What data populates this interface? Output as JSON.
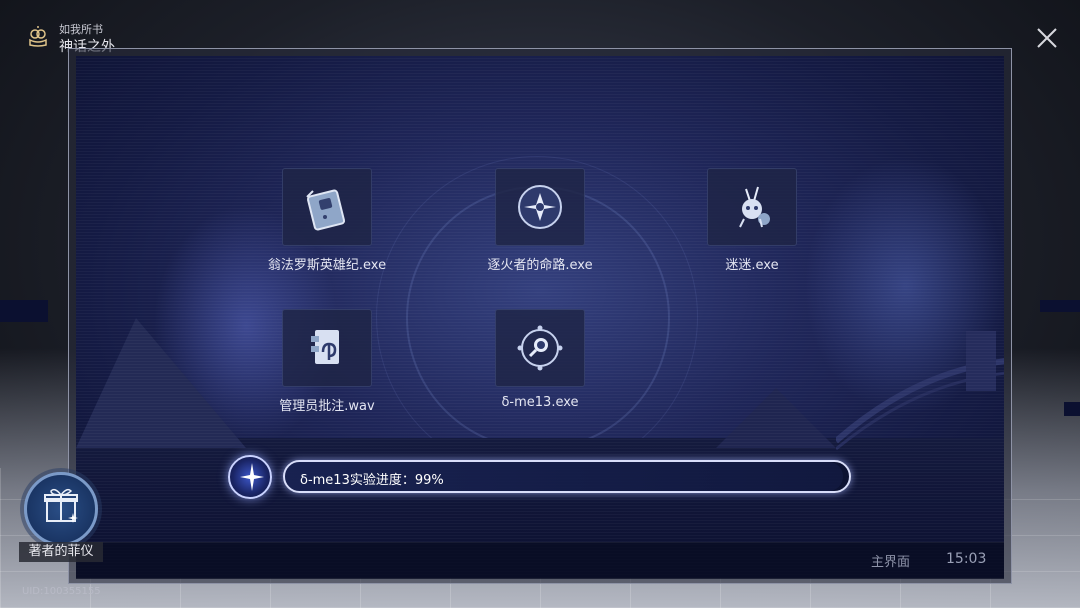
{
  "header": {
    "book_subtitle": "如我所书",
    "book_title": "神话之外"
  },
  "apps": [
    {
      "label": "翁法罗斯英雄纪.exe",
      "icon": "hero-book-icon"
    },
    {
      "label": "逐火者的命路.exe",
      "icon": "flame-flower-icon"
    },
    {
      "label": "迷迷.exe",
      "icon": "mimi-creature-icon"
    },
    {
      "label": "管理员批注.wav",
      "icon": "audio-document-icon"
    },
    {
      "label": "δ-me13.exe",
      "icon": "magnifier-orb-icon"
    }
  ],
  "progress": {
    "text": "δ-me13实验进度：99%",
    "percent": 99
  },
  "taskbar": {
    "main_label": "主界面",
    "time": "15:03"
  },
  "gift": {
    "label": "著者的菲仪"
  },
  "uid": "UID:100355155",
  "colors": {
    "screen_bg": "#1f2659",
    "progress_border": "#d9defa",
    "gift_ring": "#7b9ac8"
  }
}
